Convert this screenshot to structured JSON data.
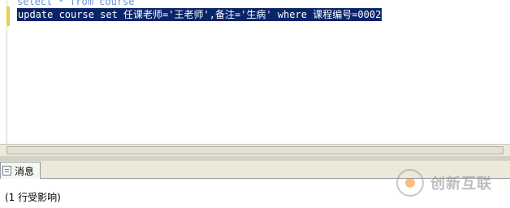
{
  "editor": {
    "line1": "select * from course",
    "line2": "update course set 任课老师='王老师',备注='生病' where 课程编号=0002"
  },
  "tabs": [
    {
      "label": "消息"
    }
  ],
  "messages": {
    "text": "(1 行受影响)"
  },
  "watermark": {
    "text": "创新互联"
  },
  "colors": {
    "selection_bg": "#0a246a",
    "keyword": "#6d8fd6",
    "chrome": "#ece9d8"
  }
}
